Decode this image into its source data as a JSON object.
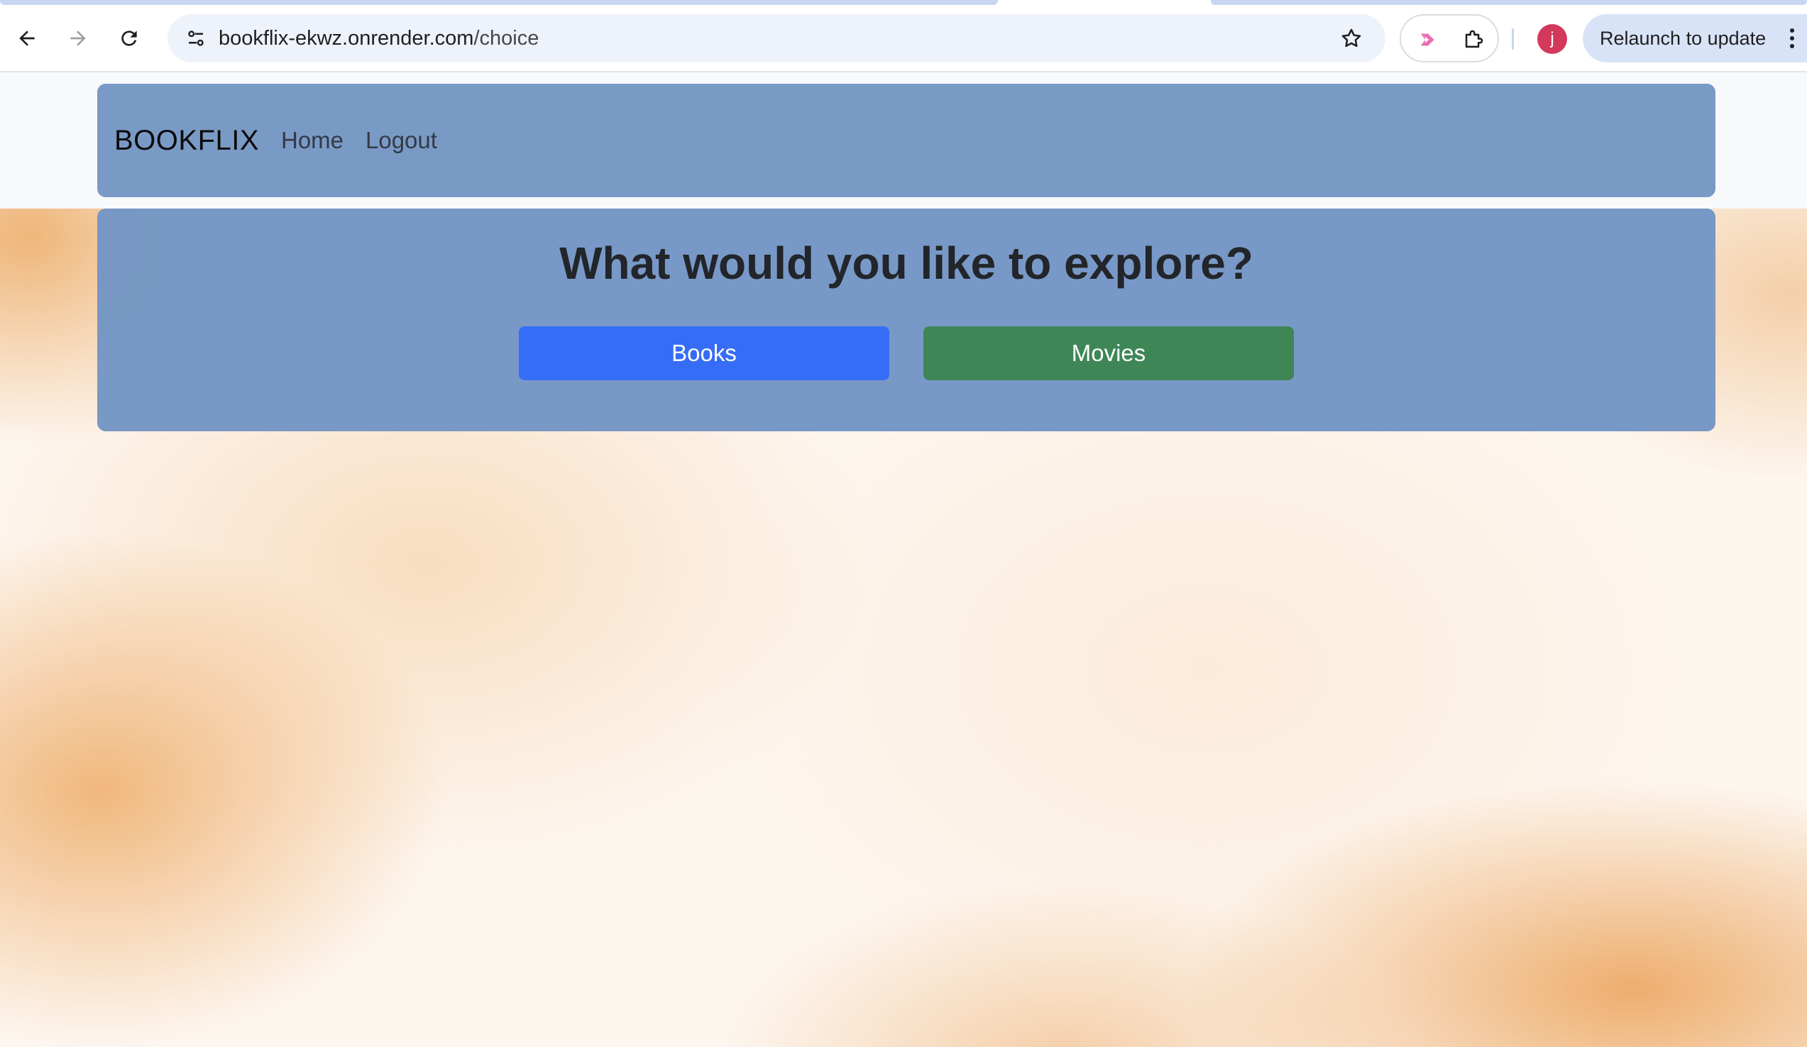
{
  "browser": {
    "url_host": "bookflix-ekwz.onrender.com",
    "url_path": "/choice",
    "avatar_letter": "j",
    "relaunch_label": "Relaunch to update",
    "accent_color": "#d9e3f8"
  },
  "navbar": {
    "brand": "BOOKFLIX",
    "links": [
      {
        "label": "Home"
      },
      {
        "label": "Logout"
      }
    ],
    "background": "#7a9ac6"
  },
  "hero": {
    "title": "What would you like to explore?",
    "buttons": [
      {
        "label": "Books",
        "color": "#366df6"
      },
      {
        "label": "Movies",
        "color": "#3f8656"
      }
    ]
  }
}
